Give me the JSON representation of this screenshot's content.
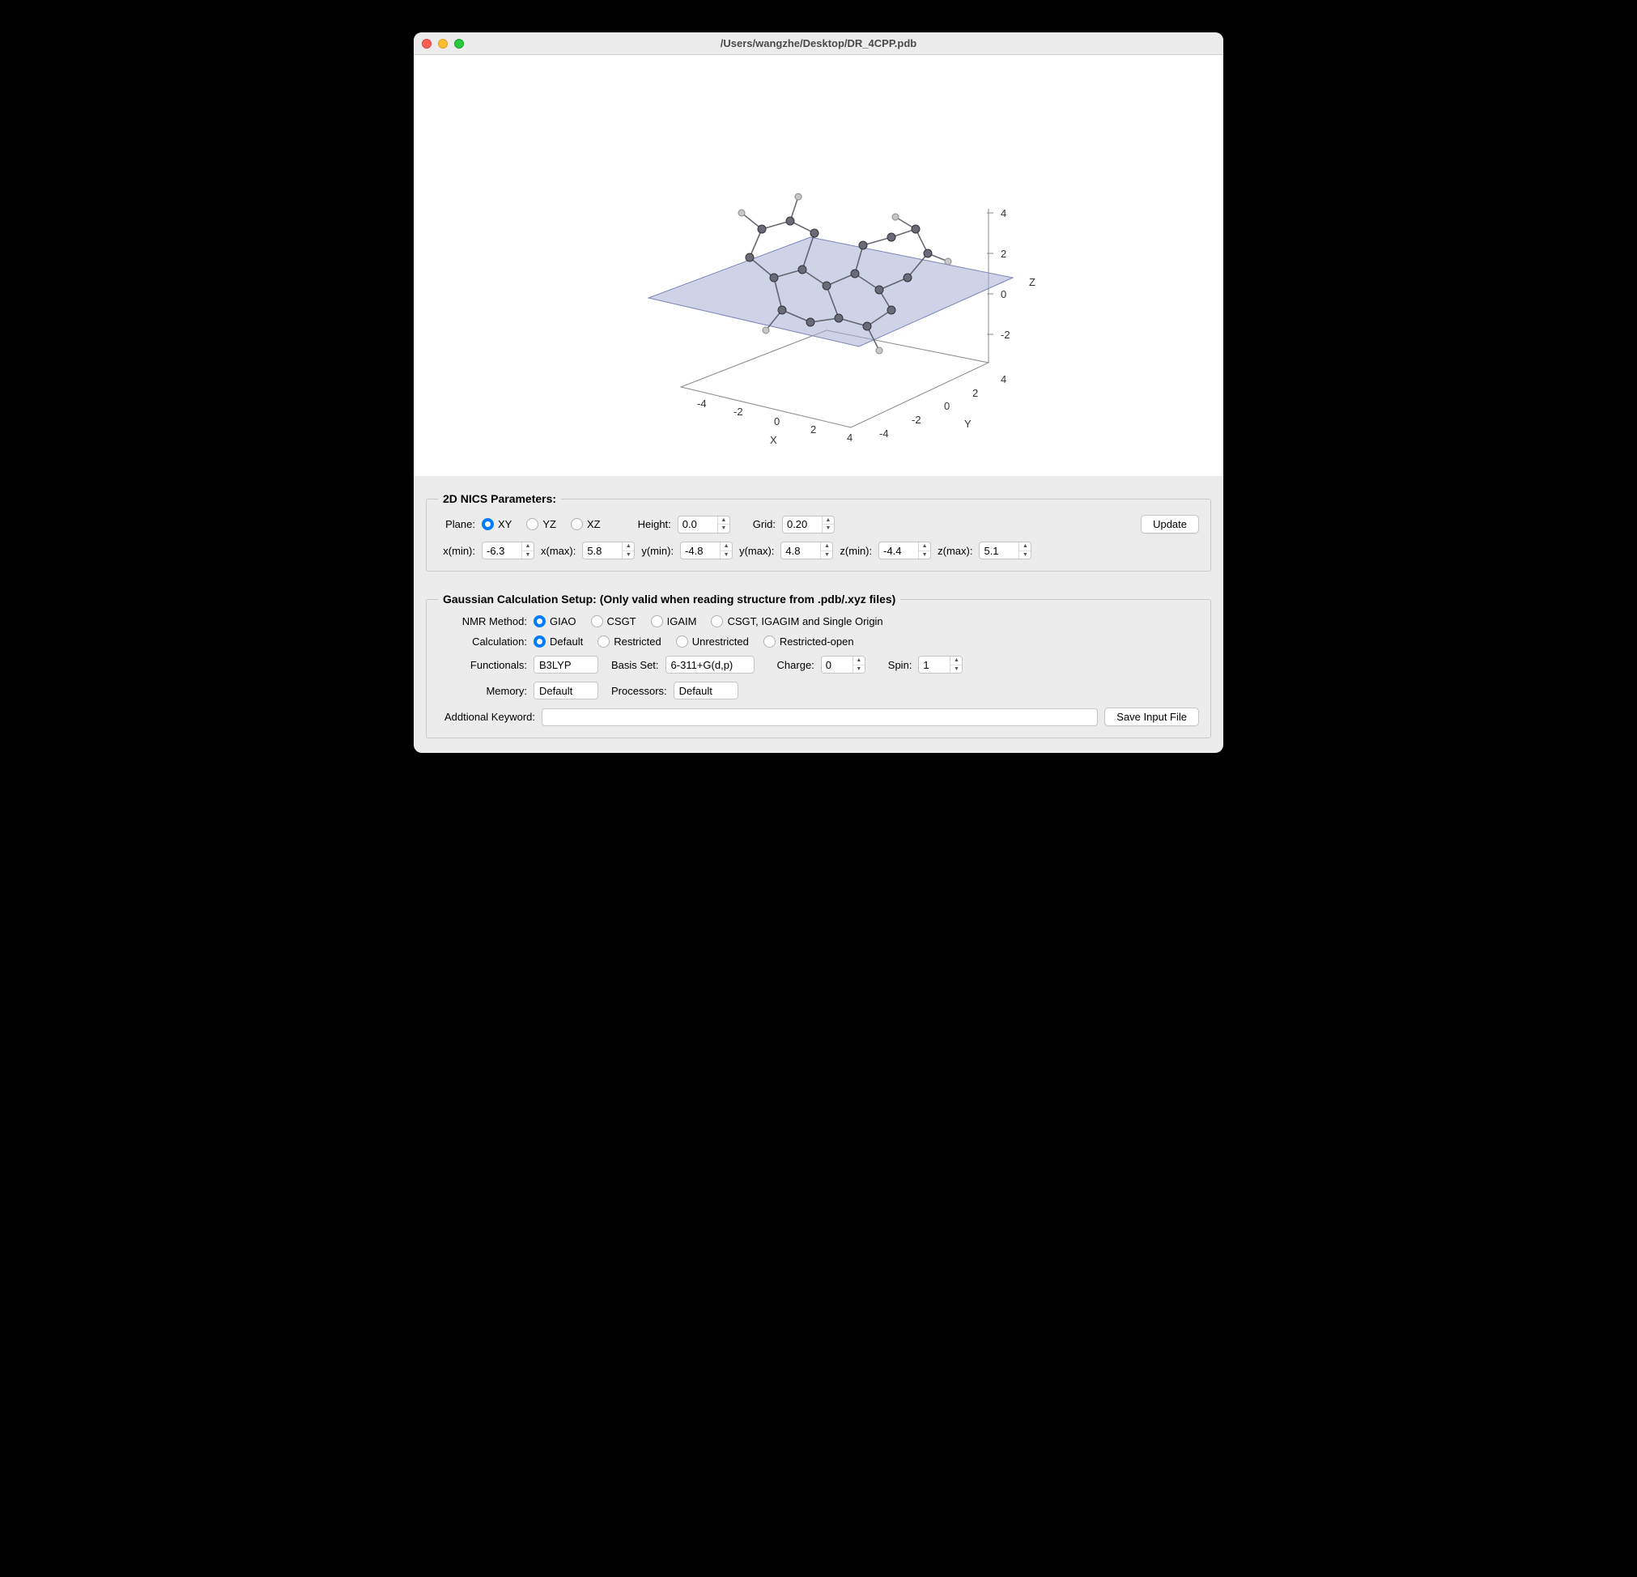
{
  "title": "/Users/wangzhe/Desktop/DR_4CPP.pdb",
  "plot": {
    "x_label": "X",
    "y_label": "Y",
    "z_label": "Z",
    "x_ticks": [
      "-4",
      "-2",
      "0",
      "2",
      "4"
    ],
    "y_ticks": [
      "-4",
      "-2",
      "0",
      "2",
      "4"
    ],
    "z_ticks": [
      "-2",
      "0",
      "2",
      "4"
    ]
  },
  "nics": {
    "legend": "2D NICS Parameters:",
    "plane_label": "Plane:",
    "plane_options": {
      "xy": "XY",
      "yz": "YZ",
      "xz": "XZ"
    },
    "plane_selected": "xy",
    "height_label": "Height:",
    "height_value": "0.0",
    "grid_label": "Grid:",
    "grid_value": "0.20",
    "update_label": "Update",
    "xmin_label": "x(min):",
    "xmin_value": "-6.3",
    "xmax_label": "x(max):",
    "xmax_value": "5.8",
    "ymin_label": "y(min):",
    "ymin_value": "-4.8",
    "ymax_label": "y(max):",
    "ymax_value": "4.8",
    "zmin_label": "z(min):",
    "zmin_value": "-4.4",
    "zmax_label": "z(max):",
    "zmax_value": "5.1"
  },
  "gauss": {
    "legend": "Gaussian Calculation Setup: (Only valid when reading structure from .pdb/.xyz files)",
    "nmr_label": "NMR Method:",
    "nmr_options": {
      "giao": "GIAO",
      "csgt": "CSGT",
      "igaim": "IGAIM",
      "all": "CSGT, IGAGIM and Single Origin"
    },
    "nmr_selected": "giao",
    "calc_label": "Calculation:",
    "calc_options": {
      "def": "Default",
      "r": "Restricted",
      "u": "Unrestricted",
      "ro": "Restricted-open"
    },
    "calc_selected": "def",
    "func_label": "Functionals:",
    "func_value": "B3LYP",
    "basis_label": "Basis Set:",
    "basis_value": "6-311+G(d,p)",
    "charge_label": "Charge:",
    "charge_value": "0",
    "spin_label": "Spin:",
    "spin_value": "1",
    "mem_label": "Memory:",
    "mem_value": "Default",
    "proc_label": "Processors:",
    "proc_value": "Default",
    "keyword_label": "Addtional Keyword:",
    "keyword_value": "",
    "save_label": "Save Input File"
  }
}
